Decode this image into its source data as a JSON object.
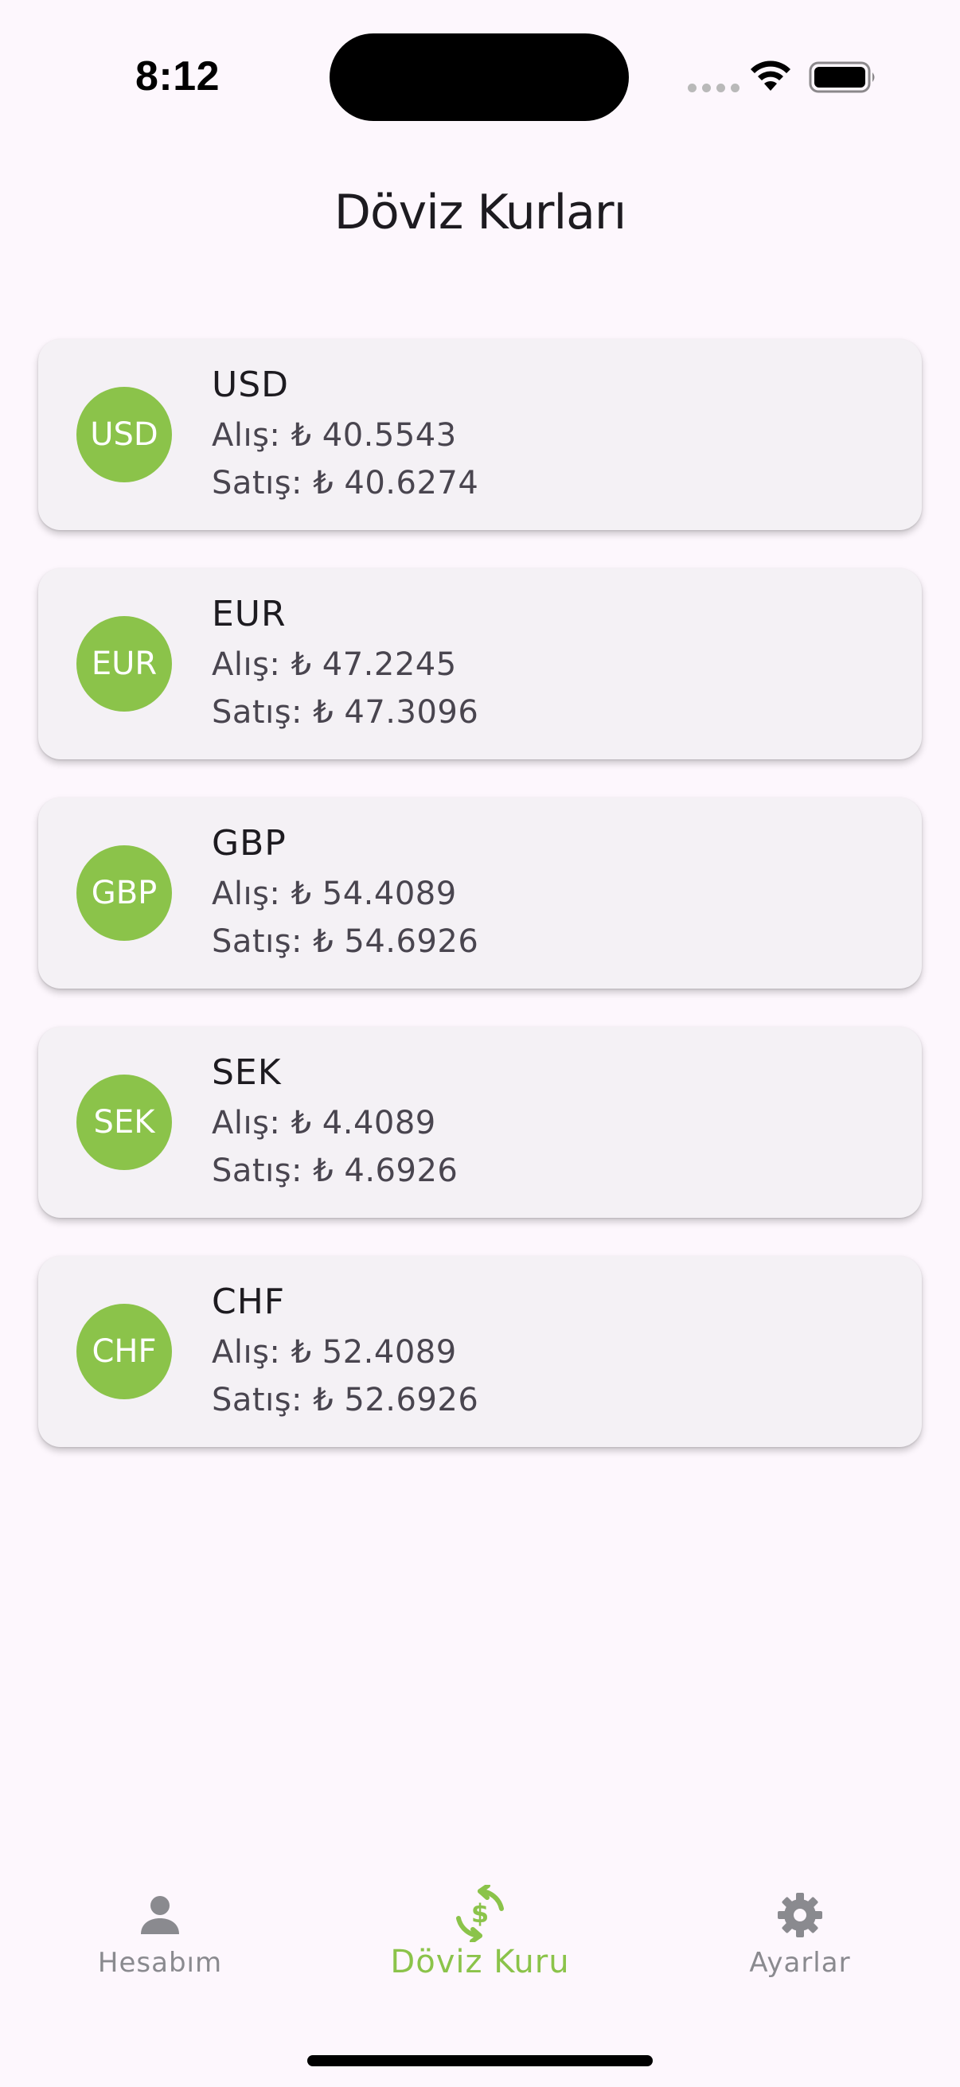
{
  "status_bar": {
    "time": "8:12"
  },
  "header": {
    "title": "Döviz Kurları"
  },
  "currencies": [
    {
      "code": "USD",
      "avatar": "USD",
      "buy": "Alış: ₺ 40.5543",
      "sell": "Satış: ₺ 40.6274"
    },
    {
      "code": "EUR",
      "avatar": "EUR",
      "buy": "Alış: ₺ 47.2245",
      "sell": "Satış: ₺ 47.3096"
    },
    {
      "code": "GBP",
      "avatar": "GBP",
      "buy": "Alış: ₺ 54.4089",
      "sell": "Satış: ₺ 54.6926"
    },
    {
      "code": "SEK",
      "avatar": "SEK",
      "buy": "Alış: ₺ 4.4089",
      "sell": "Satış: ₺ 4.6926"
    },
    {
      "code": "CHF",
      "avatar": "CHF",
      "buy": "Alış: ₺ 52.4089",
      "sell": "Satış: ₺ 52.6926"
    }
  ],
  "bottom_nav": {
    "items": [
      {
        "label": "Hesabım",
        "icon": "person-icon",
        "active": false
      },
      {
        "label": "Döviz Kuru",
        "icon": "currency-exchange-icon",
        "active": true
      },
      {
        "label": "Ayarlar",
        "icon": "gear-icon",
        "active": false
      }
    ]
  },
  "colors": {
    "accent": "#8bc34a",
    "background": "#fdf7fd",
    "card": "#f4f1f5",
    "inactive": "#8a8a8f"
  }
}
